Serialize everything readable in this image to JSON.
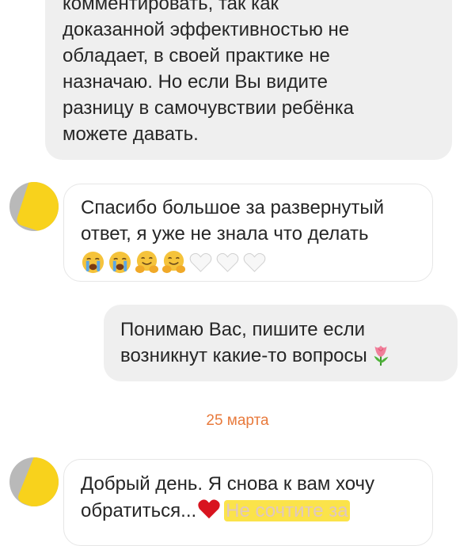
{
  "messages": [
    {
      "id": "doctor-1",
      "lines": [
        "комментировать, так как",
        "доказанной эффективностью не",
        "обладает, в своей практике не",
        "назначаю. Но если Вы видите",
        "разницу в самочувствии ребёнка",
        "можете давать."
      ]
    },
    {
      "id": "user-1",
      "lines": [
        "Спасибо большое за развернутый",
        "ответ, я уже не знала что делать"
      ],
      "emojis": [
        "crying-face",
        "crying-face",
        "hugging-face",
        "hugging-face",
        "white-heart",
        "white-heart",
        "white-heart"
      ]
    },
    {
      "id": "doctor-2",
      "lines": [
        "Понимаю Вас, пишите если",
        "возникнут какие-то вопросы"
      ],
      "trailing_emoji": "tulip"
    },
    {
      "id": "user-2",
      "line1": "Добрый день. Я снова к вам хочу",
      "line2_prefix": "обратиться...",
      "line2_emoji": "red-heart",
      "line2_highlight": "Не сочтите за"
    }
  ],
  "date_separator": "25 марта",
  "colors": {
    "incoming_bg": "#efefef",
    "date_text": "#e87a3c",
    "redaction": "#f8d21c"
  }
}
